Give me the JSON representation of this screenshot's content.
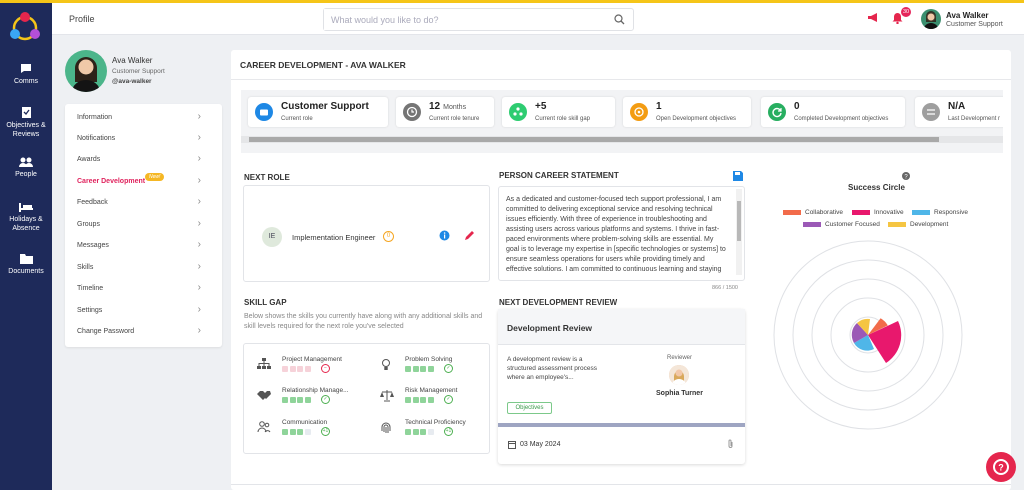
{
  "nav": [
    {
      "label": "Comms",
      "icon": "chat-icon"
    },
    {
      "label": "Objectives & Reviews",
      "icon": "clipboard-check-icon"
    },
    {
      "label": "People",
      "icon": "people-icon"
    },
    {
      "label": "Holidays & Absence",
      "icon": "bed-icon"
    },
    {
      "label": "Documents",
      "icon": "folder-icon"
    }
  ],
  "header": {
    "breadcrumb": "Profile",
    "search_placeholder": "What would you like to do?",
    "notifications": "30",
    "user_name": "Ava Walker",
    "user_role": "Customer Support"
  },
  "profile": {
    "name": "Ava Walker",
    "role": "Customer Support",
    "handle": "@ava-walker"
  },
  "menu": {
    "items": [
      "Information",
      "Notifications",
      "Awards",
      "Career Development",
      "Feedback",
      "Groups",
      "Messages",
      "Skills",
      "Timeline",
      "Settings",
      "Change Password"
    ],
    "new_badge": "New!"
  },
  "main": {
    "title": "CAREER DEVELOPMENT - AVA WALKER"
  },
  "cards": [
    {
      "value": "Customer Support",
      "suffix": "",
      "label": "Current role",
      "color": "#1e88e5",
      "icon": "briefcase-icon"
    },
    {
      "value": "12",
      "suffix": "Months",
      "label": "Current role tenure",
      "color": "#757575",
      "icon": "clock-icon"
    },
    {
      "value": "+5",
      "suffix": "",
      "label": "Current role skill gap",
      "color": "#2ecc71",
      "icon": "network-icon"
    },
    {
      "value": "1",
      "suffix": "",
      "label": "Open Development objectives",
      "color": "#f39c12",
      "icon": "target-icon"
    },
    {
      "value": "0",
      "suffix": "",
      "label": "Completed Development objectives",
      "color": "#27ae60",
      "icon": "refresh-icon"
    },
    {
      "value": "N/A",
      "suffix": "",
      "label": "Last Development r",
      "color": "#9e9e9e",
      "icon": "swap-icon"
    }
  ],
  "next_role": {
    "heading": "NEXT ROLE",
    "initials": "IE",
    "name": "Implementation Engineer",
    "badge": "0"
  },
  "statement": {
    "heading": "PERSON CAREER STATEMENT",
    "text": "As a dedicated and customer-focused tech support professional, I am committed to delivering exceptional service and resolving technical issues efficiently. With three of experience in troubleshooting and assisting users across various platforms and systems. I thrive in fast-paced environments where problem-solving skills are essential. My goal is to leverage my expertise in [specific technologies or systems] to ensure seamless operations for users while providing timely and effective solutions. I am committed to continuous learning and staying up to date with the latest technology",
    "count": "866 / 1500"
  },
  "skill_gap": {
    "heading": "SKILL GAP",
    "description": "Below shows the skills you currently have along with any additional skills and skill levels required for the next role you've selected",
    "skills": [
      {
        "name": "Project Management",
        "filled": 0,
        "status": "minus",
        "icon": "org-chart-icon"
      },
      {
        "name": "Problem Solving",
        "filled": 4,
        "status": "check",
        "icon": "bulb-icon"
      },
      {
        "name": "Relationship Manage...",
        "filled": 4,
        "status": "check",
        "icon": "handshake-icon"
      },
      {
        "name": "Risk Management",
        "filled": 4,
        "status": "check",
        "icon": "scale-icon"
      },
      {
        "name": "Communication",
        "filled": 3,
        "status": "+1",
        "icon": "users-icon"
      },
      {
        "name": "Technical Proficiency",
        "filled": 3,
        "status": "+1",
        "icon": "fingerprint-icon"
      }
    ]
  },
  "review": {
    "heading": "NEXT DEVELOPMENT REVIEW",
    "title": "Development Review",
    "desc": "A development review is a structured assessment process where an employee's...",
    "reviewer_label": "Reviewer",
    "reviewer": "Sophia Turner",
    "button": "Objectives",
    "date": "03 May 2024"
  },
  "success": {
    "title": "Success Circle",
    "legend": [
      {
        "name": "Collaborative",
        "color": "#f26b4a"
      },
      {
        "name": "Innovative",
        "color": "#e8186d"
      },
      {
        "name": "Responsive",
        "color": "#4fb6e8"
      },
      {
        "name": "Customer Focused",
        "color": "#9b59b6"
      },
      {
        "name": "Development",
        "color": "#f5c542"
      }
    ]
  }
}
